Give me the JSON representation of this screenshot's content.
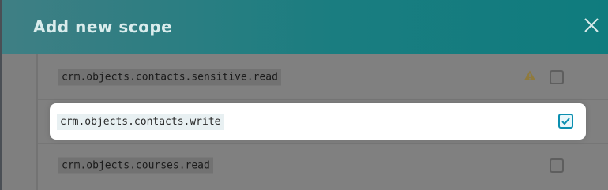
{
  "dialog": {
    "title": "Add new scope",
    "close_icon": "close-icon"
  },
  "scopes": [
    {
      "name": "crm.objects.contacts.sensitive.read",
      "checked": false,
      "warning": true
    },
    {
      "name": "crm.objects.contacts.write",
      "checked": true,
      "warning": false
    },
    {
      "name": "crm.objects.courses.read",
      "checked": false,
      "warning": false
    }
  ],
  "colors": {
    "header_start": "#3f7f84",
    "header_end": "#0f7c7e",
    "checkbox_accent": "#0b8fb0",
    "warning": "#d4a21d"
  }
}
